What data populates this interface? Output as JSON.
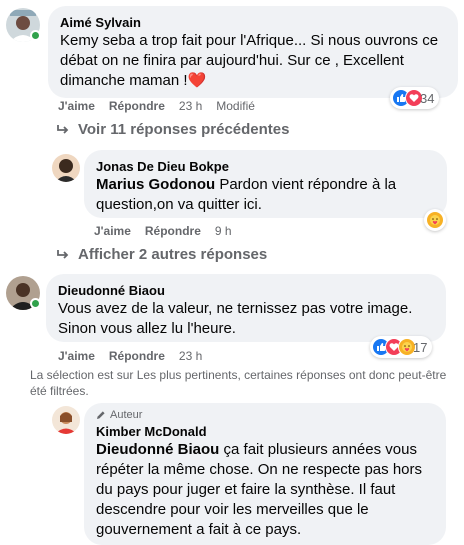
{
  "comments": [
    {
      "author": "Aimé Sylvain",
      "text": "Kemy seba a trop fait pour l'Afrique... Si nous ouvrons ce débat on ne finira par aujourd'hui. Sur ce , Excellent dimanche maman !",
      "emoji": "❤️",
      "like_label": "J'aime",
      "reply_label": "Répondre",
      "time": "23 h",
      "edited": "Modifié",
      "reaction_count": "34",
      "reactions": [
        "like-icon",
        "love-icon"
      ]
    },
    {
      "author": "Jonas De Dieu Bokpe",
      "mention": "Marius Godonou",
      "text": " Pardon vient répondre à la question,on va quitter ici.",
      "like_label": "J'aime",
      "reply_label": "Répondre",
      "time": "9 h",
      "reactions": [
        "care-icon"
      ]
    },
    {
      "author": "Dieudonné Biaou",
      "text": "Vous avez de la valeur, ne ternissez pas votre image. Sinon vous allez lu l'heure.",
      "like_label": "J'aime",
      "reply_label": "Répondre",
      "time": "23 h",
      "reaction_count": "17",
      "reactions": [
        "like-icon",
        "love-icon",
        "care-icon"
      ]
    },
    {
      "badge": "Auteur",
      "author": "Kimber McDonald",
      "mention": "Dieudonné Biaou",
      "text": " ça fait plusieurs années vous répéter la même chose. On ne respecte pas hors du pays pour juger et faire la synthèse. Il faut descendre pour voir les merveilles que le gouvernement a fait à ce pays."
    }
  ],
  "links": {
    "previous_replies": "Voir 11 réponses précédentes",
    "more_replies": "Afficher 2 autres réponses"
  },
  "notice": "La sélection est sur Les plus pertinents, certaines réponses ont donc peut-être été filtrées.",
  "colors": {
    "like": "#1877f2",
    "love": "#f33e58",
    "care": "#f7b125",
    "online": "#31a24c",
    "bubble": "#f0f2f5"
  }
}
